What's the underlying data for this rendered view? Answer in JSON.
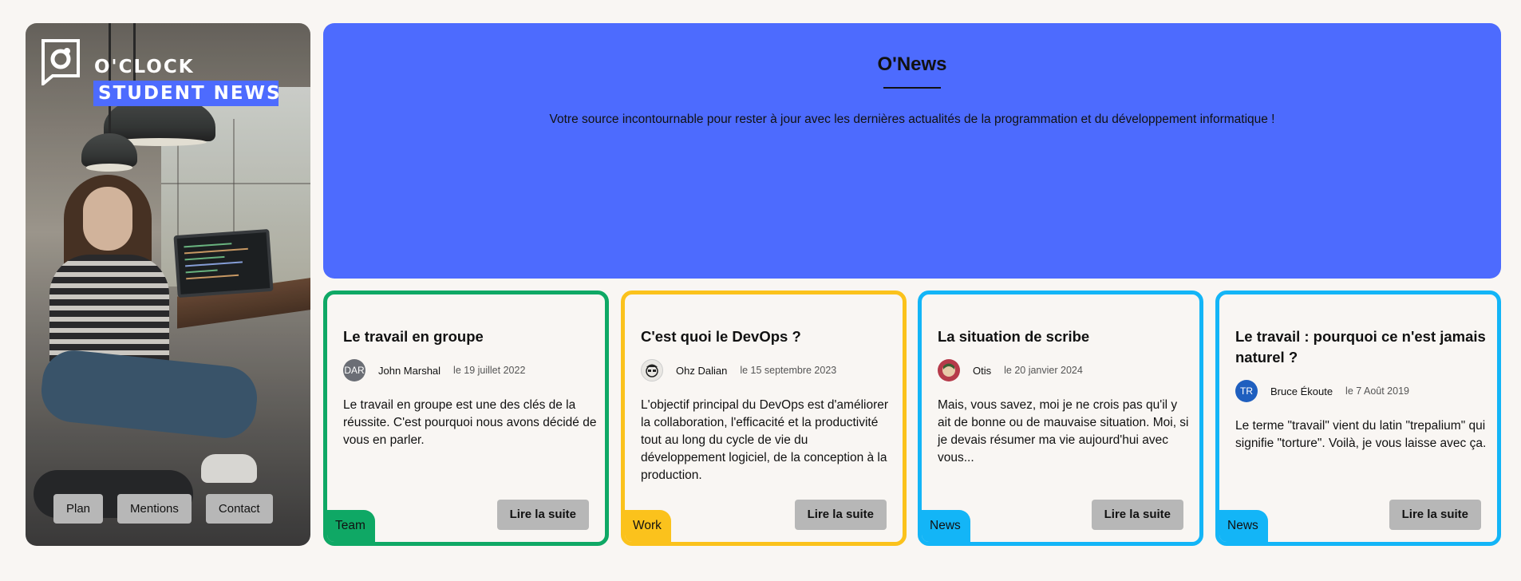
{
  "brand": {
    "line1": "O'CLOCK",
    "line2": "STUDENT NEWS"
  },
  "nav": [
    "Plan",
    "Mentions",
    "Contact"
  ],
  "header": {
    "title": "O'News",
    "subtitle": "Votre source incontournable pour rester à jour avec les dernières actualités de la programmation et du développement informatique !"
  },
  "cards": [
    {
      "title": "Le travail en groupe",
      "author": "John Marshal",
      "avatar_text": "DAR",
      "date": "le 19 juillet 2022",
      "excerpt": "Le travail en groupe est une des clés de la réussite. C'est pourquoi nous avons décidé de vous en parler.",
      "button": "Lire la suite",
      "tag": "Team",
      "color": "#0fa865"
    },
    {
      "title": "C'est quoi le DevOps ?",
      "author": "Ohz Dalian",
      "avatar_text": "",
      "date": "le 15 septembre 2023",
      "excerpt": "L'objectif principal du DevOps est d'améliorer la collaboration, l'efficacité et la productivité tout au long du cycle de vie du développement logiciel, de la conception à la production.",
      "button": "Lire la suite",
      "tag": "Work",
      "color": "#fbc21c"
    },
    {
      "title": "La situation de scribe",
      "author": "Otis",
      "avatar_text": "",
      "date": "le 20 janvier 2024",
      "excerpt": "Mais, vous savez, moi je ne crois pas qu'il y ait de bonne ou de mauvaise situation. Moi, si je devais résumer ma vie aujourd'hui avec vous...",
      "button": "Lire la suite",
      "tag": "News",
      "color": "#13b5f7"
    },
    {
      "title": "Le travail : pourquoi ce n'est jamais naturel ?",
      "author": "Bruce Ékoute",
      "avatar_text": "TR",
      "date": "le 7 Août 2019",
      "excerpt": "Le terme \"travail\" vient du latin \"trepalium\" qui signifie \"torture\". Voilà, je vous laisse avec ça.",
      "button": "Lire la suite",
      "tag": "News",
      "color": "#13b5f7"
    }
  ]
}
